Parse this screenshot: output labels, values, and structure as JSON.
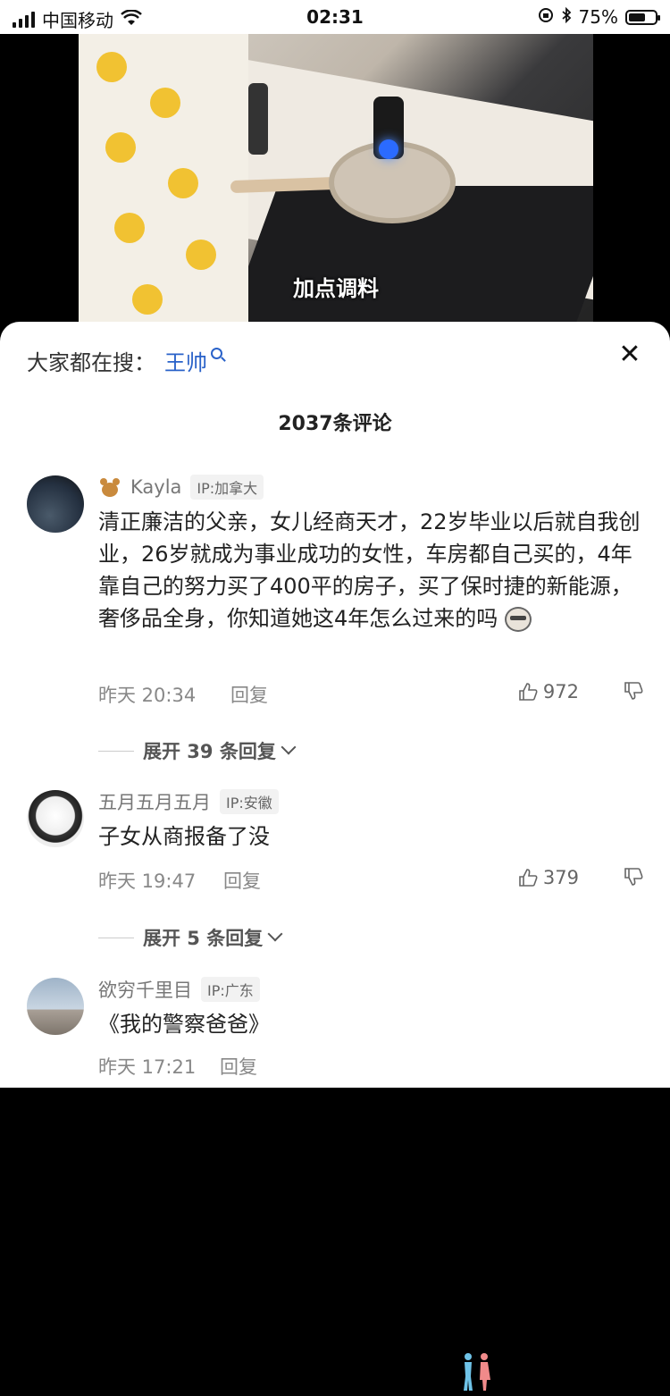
{
  "status_bar": {
    "carrier": "中国移动",
    "time": "02:31",
    "battery": "75%",
    "battery_level": 0.75
  },
  "video": {
    "subtitle": "加点调料"
  },
  "search": {
    "label": "大家都在搜：",
    "term": "王帅"
  },
  "comments_header": {
    "count_label": "2037条评论"
  },
  "comments": [
    {
      "user": "Kayla",
      "ip": "IP:加拿大",
      "text": "清正廉洁的父亲，女儿经商天才，22岁毕业以后就自我创业，26岁就成为事业成功的女性，车房都自己买的，4年靠自己的努力买了400平的房子，买了保时捷的新能源，奢侈品全身，你知道她这4年怎么过来的吗",
      "time": "昨天 20:34",
      "reply_label": "回复",
      "likes": "972",
      "expand": "展开 39 条回复"
    },
    {
      "user": "五月五月五月",
      "ip": "IP:安徽",
      "text": "子女从商报备了没",
      "time": "昨天 19:47",
      "reply_label": "回复",
      "likes": "379",
      "expand": "展开 5 条回复"
    },
    {
      "user": "欲穷千里目",
      "ip": "IP:广东",
      "text": "《我的警察爸爸》",
      "time": "昨天 17:21",
      "reply_label": "回复"
    }
  ]
}
